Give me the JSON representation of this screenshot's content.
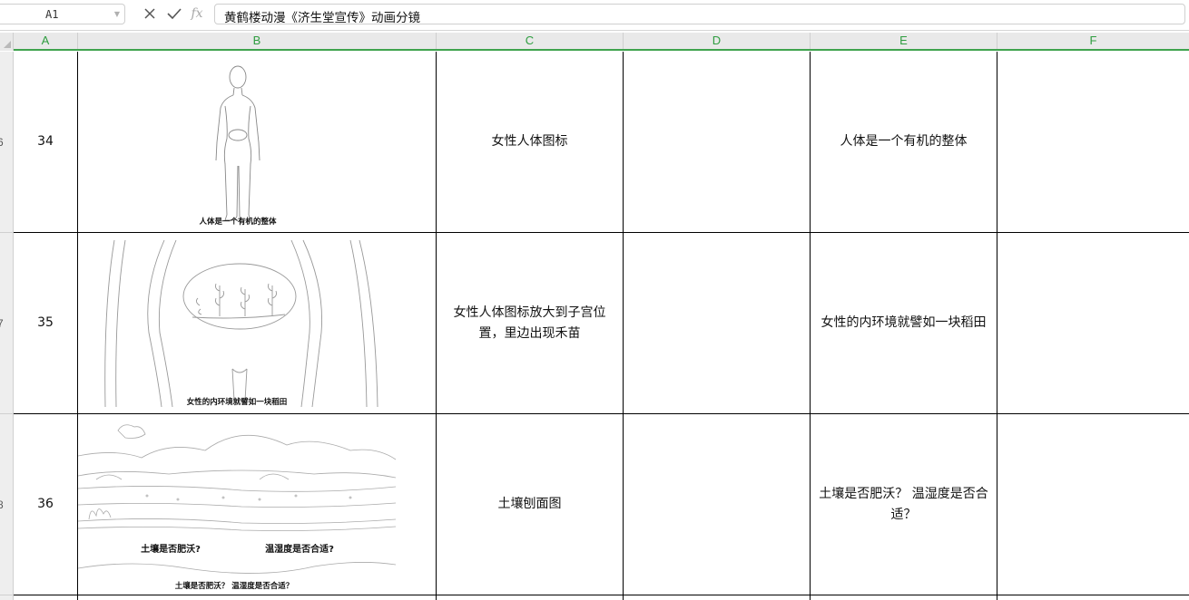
{
  "formula_bar": {
    "name_box": "A1",
    "cancel_icon": "close-icon",
    "confirm_icon": "check-icon",
    "function_label": "fx",
    "formula": "黄鹤楼动漫《济生堂宣传》动画分镜"
  },
  "columns": [
    "A",
    "B",
    "C",
    "D",
    "E",
    "F"
  ],
  "rows": [
    {
      "row_number": "6",
      "shot": "34",
      "image_caption": "人体是一个有机的整体",
      "description": "女性人体图标",
      "col_d": "",
      "narration": "人体是一个有机的整体",
      "col_f": ""
    },
    {
      "row_number": "7",
      "shot": "35",
      "image_caption": "女性的内环境就譬如一块稻田",
      "description": "女性人体图标放大到子宫位置，里边出现禾苗",
      "col_d": "",
      "narration": "女性的内环境就譬如一块稻田",
      "col_f": ""
    },
    {
      "row_number": "8",
      "shot": "36",
      "image_caption": "土壤是否肥沃？ 温湿度是否合适？",
      "image_label_left": "土壤是否肥沃?",
      "image_label_right": "温湿度是否合适?",
      "description": "土壤刨面图",
      "col_d": "",
      "narration": "土壤是否肥沃？ 温湿度是否合适？",
      "col_f": ""
    }
  ],
  "colors": {
    "header_text": "#2e9d3f",
    "header_underline": "#3fa34d",
    "header_bg": "#e9e9e9",
    "cell_border": "#000000"
  }
}
